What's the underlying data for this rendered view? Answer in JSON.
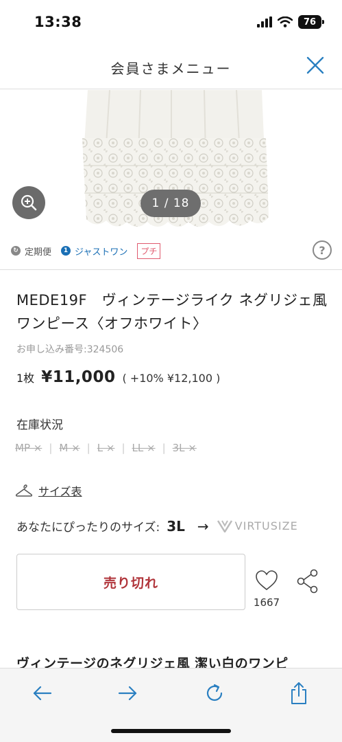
{
  "status_bar": {
    "time": "13:38",
    "battery": "76"
  },
  "header": {
    "title": "会員さまメニュー"
  },
  "gallery": {
    "counter": "1 / 18"
  },
  "badges": {
    "teiki": "定期便",
    "just_one": "ジャストワン",
    "petit": "プチ",
    "help": "?"
  },
  "product": {
    "title": "MEDE19F　ヴィンテージライク ネグリジェ風ワンピース〈オフホワイト〉",
    "order_no": "お申し込み番号:324506",
    "qty": "1枚",
    "price": "¥11,000",
    "tax": "( +10%  ¥12,100 )"
  },
  "stock": {
    "title": "在庫状況",
    "items": [
      "MP ×",
      "M ×",
      "L ×",
      "LL ×",
      "3L ×"
    ]
  },
  "size_chart": {
    "label": "サイズ表"
  },
  "fit": {
    "label": "あなたにぴったりのサイズ:",
    "size": "3L",
    "arrow": "→",
    "brand": "VIRTUSIZE"
  },
  "actions": {
    "soldout": "売り切れ",
    "favorite_count": "1667"
  },
  "description": {
    "heading": "ヴィンテージのネグリジェ風 潔い白のワンピ"
  },
  "colors": {
    "accent_blue": "#2a7fc1",
    "soldout_red": "#b0343a",
    "petit_pink": "#e05a6e"
  }
}
